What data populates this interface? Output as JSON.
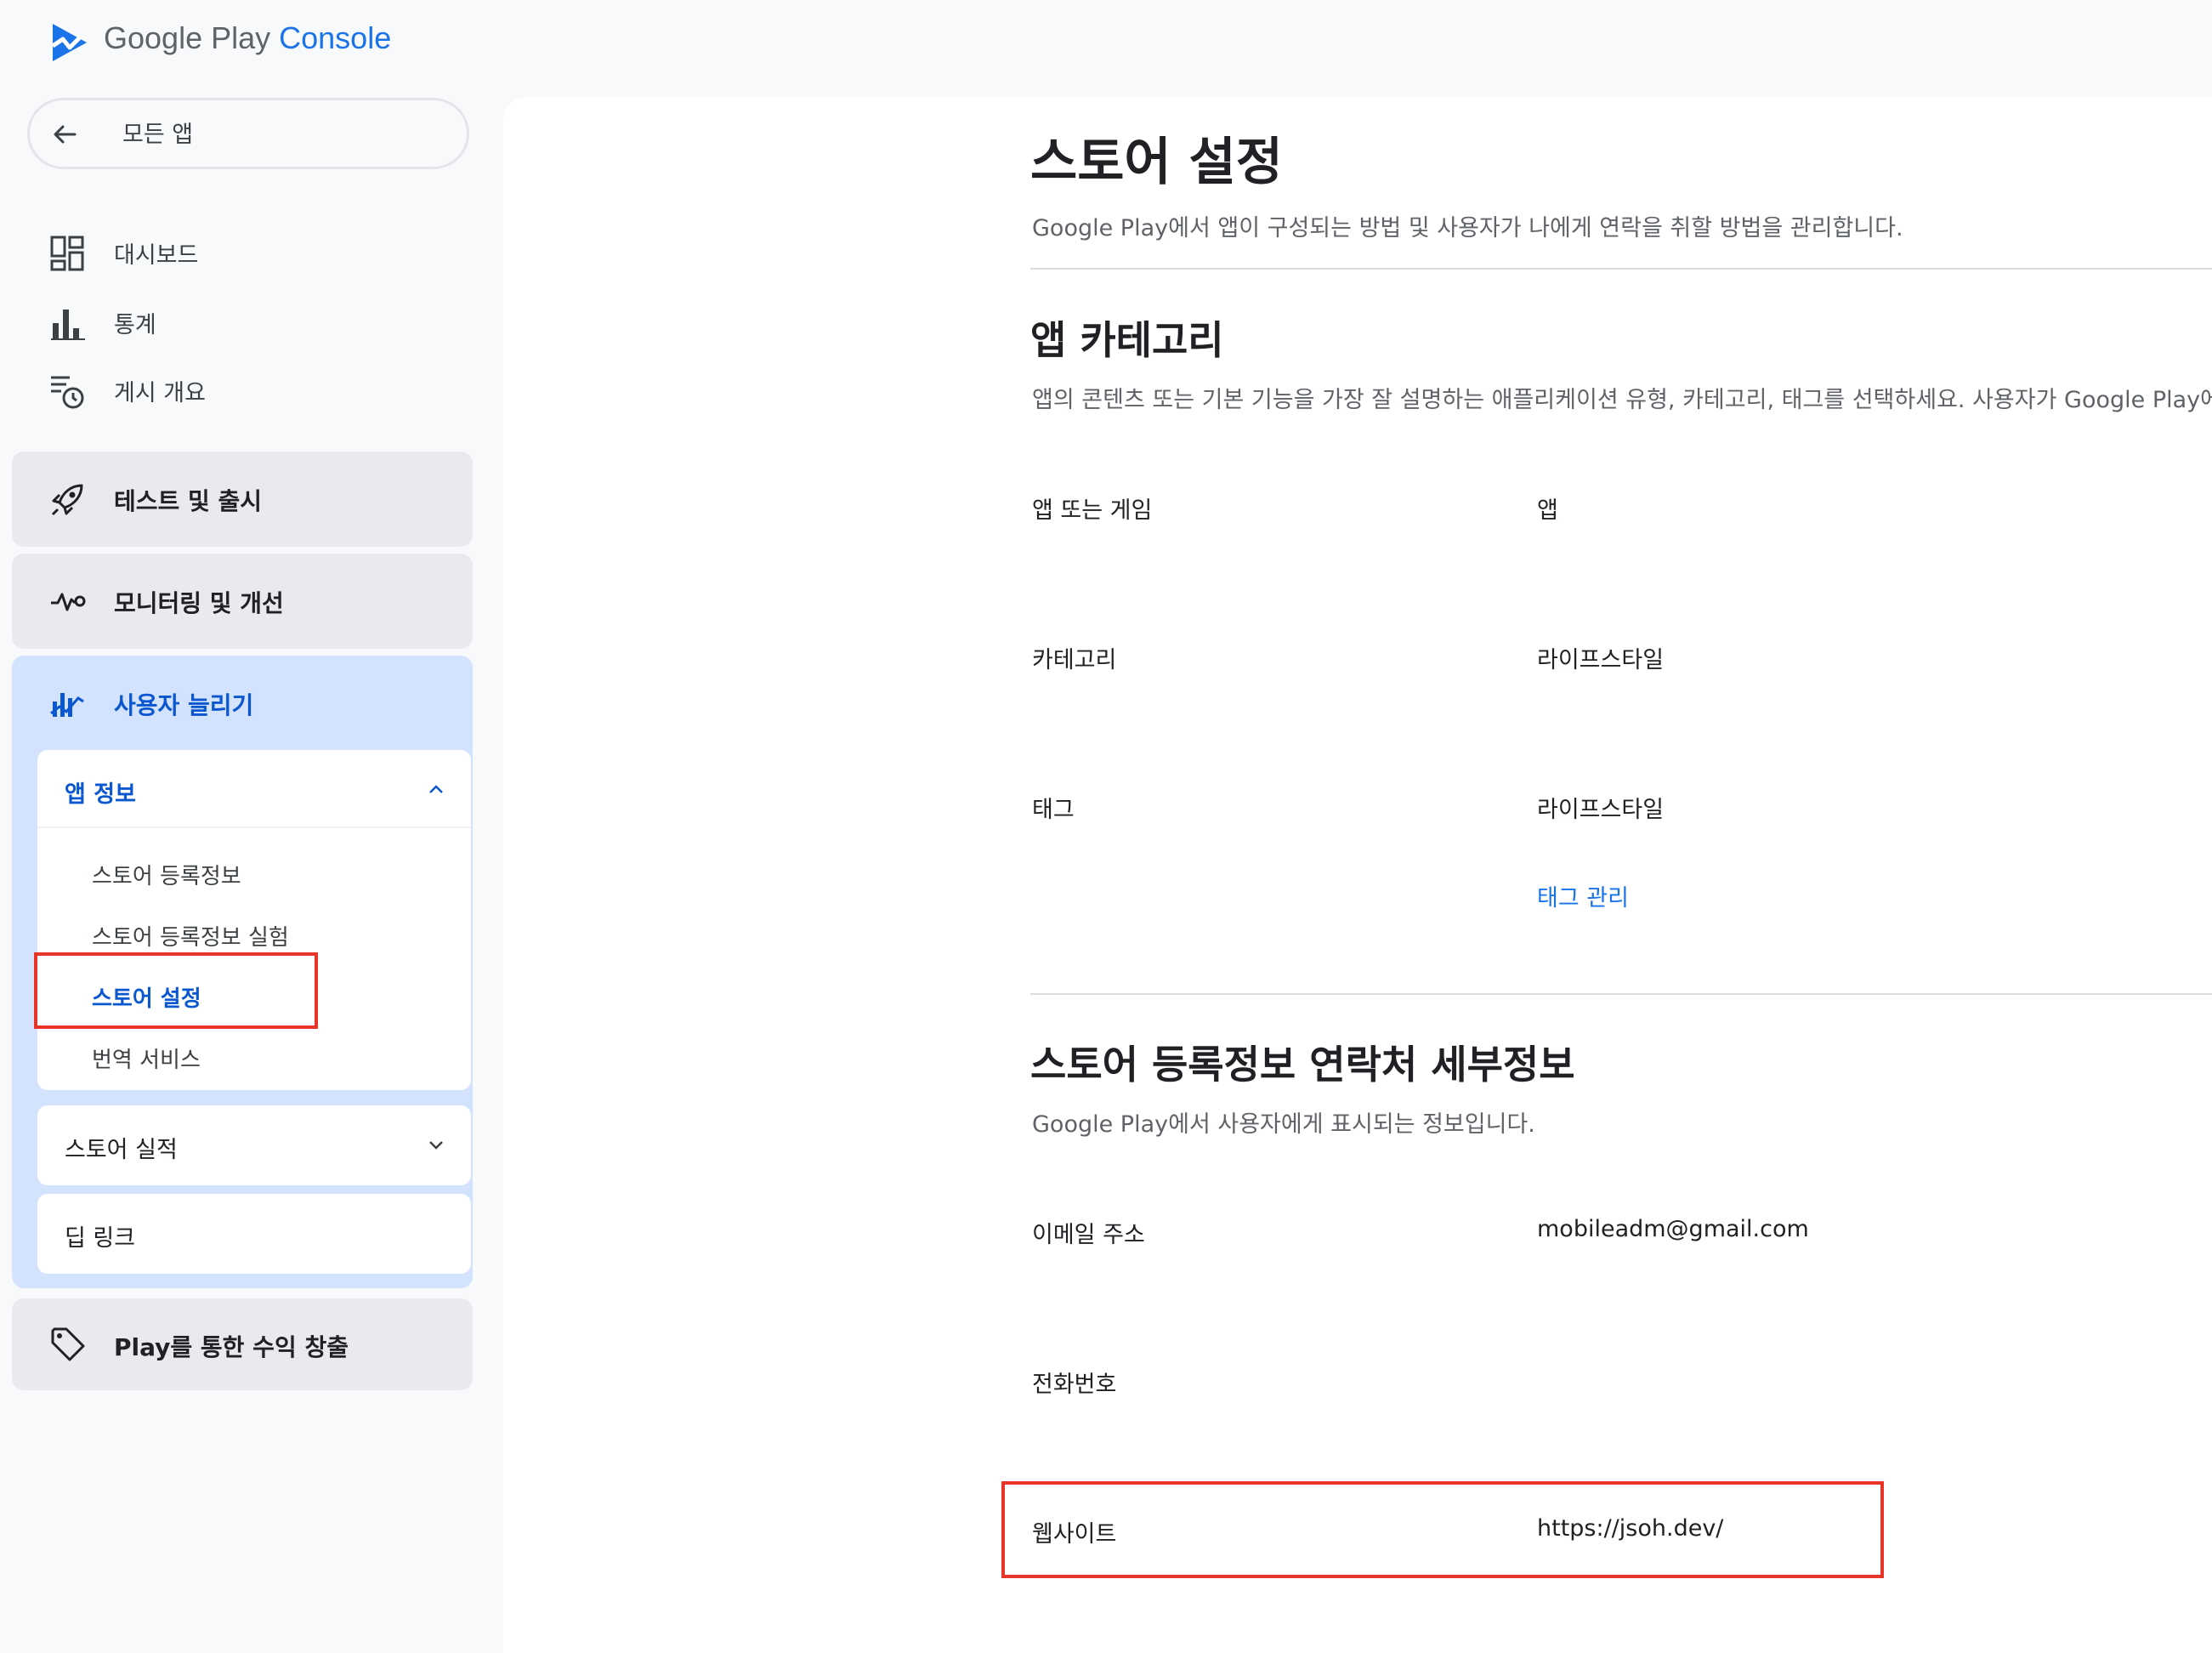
{
  "header": {
    "brand_main": "Google Play",
    "brand_accent": "Console"
  },
  "sidebar": {
    "back_label": "모든 앱",
    "top_items": [
      {
        "label": "대시보드",
        "icon": "dashboard-icon"
      },
      {
        "label": "통계",
        "icon": "bar-chart-icon"
      },
      {
        "label": "게시 개요",
        "icon": "publishing-overview-icon"
      }
    ],
    "groups": [
      {
        "label": "테스트 및 출시",
        "icon": "rocket-icon"
      },
      {
        "label": "모니터링 및 개선",
        "icon": "pulse-icon"
      },
      {
        "label": "사용자 늘리기",
        "icon": "grow-users-icon"
      },
      {
        "label": "Play를 통한 수익 창출",
        "icon": "tag-icon"
      }
    ],
    "app_info": {
      "label": "앱 정보",
      "items": [
        "스토어 등록정보",
        "스토어 등록정보 실험",
        "스토어 설정",
        "번역 서비스"
      ],
      "selected_index": 2
    },
    "store_performance": "스토어 실적",
    "deep_links": "딥 링크"
  },
  "main": {
    "title": "스토어 설정",
    "description": "Google Play에서 앱이 구성되는 방법 및 사용자가 나에게 연락을 취할 방법을 관리합니다.",
    "category_section": {
      "title": "앱 카테고리",
      "description": "앱의 콘텐츠 또는 기본 기능을 가장 잘 설명하는 애플리케이션 유형, 카테고리, 태그를 선택하세요. 사용자가 Google Play에서",
      "rows": [
        {
          "label": "앱 또는 게임",
          "value": "앱"
        },
        {
          "label": "카테고리",
          "value": "라이프스타일"
        },
        {
          "label": "태그",
          "value": "라이프스타일"
        }
      ],
      "manage_tags_link": "태그 관리"
    },
    "contact_section": {
      "title": "스토어 등록정보 연락처 세부정보",
      "description": "Google Play에서 사용자에게 표시되는 정보입니다.",
      "rows": [
        {
          "label": "이메일 주소",
          "value": "mobileadm@gmail.com"
        },
        {
          "label": "전화번호",
          "value": ""
        },
        {
          "label": "웹사이트",
          "value": "https://jsoh.dev/"
        }
      ]
    }
  },
  "colors": {
    "accent": "#0b57d0",
    "link": "#1a73e8",
    "highlight_box": "#e8352a",
    "active_group_bg": "#d3e3fd"
  }
}
